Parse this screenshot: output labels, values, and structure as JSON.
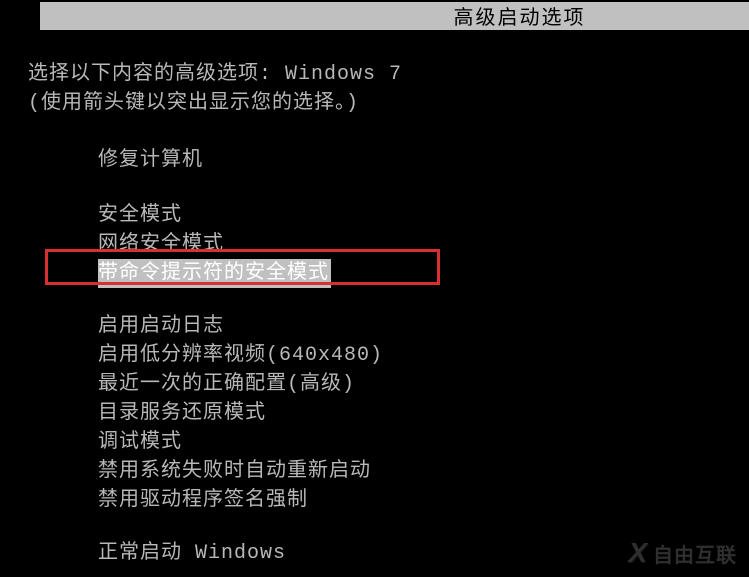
{
  "header": {
    "title": "高级启动选项"
  },
  "prompt": {
    "line1": "选择以下内容的高级选项: Windows 7",
    "line2": "(使用箭头键以突出显示您的选择。)"
  },
  "options": {
    "repair": "修复计算机",
    "safe_mode": "安全模式",
    "safe_mode_network": "网络安全模式",
    "safe_mode_cmd": "带命令提示符的安全模式",
    "boot_log": "启用启动日志",
    "low_res": "启用低分辨率视频(640x480)",
    "last_known": "最近一次的正确配置(高级)",
    "ds_restore": "目录服务还原模式",
    "debug": "调试模式",
    "disable_auto_restart": "禁用系统失败时自动重新启动",
    "disable_driver_sig": "禁用驱动程序签名强制",
    "start_normal": "正常启动 Windows"
  },
  "watermark": {
    "logo": "X",
    "text": "自由互联"
  }
}
